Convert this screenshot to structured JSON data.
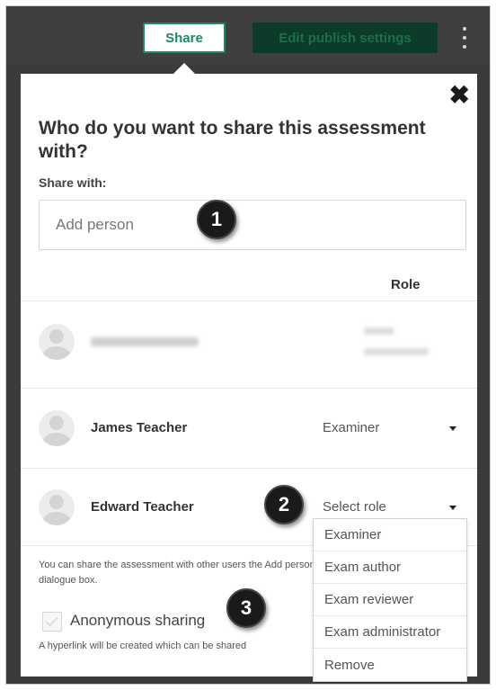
{
  "topbar": {
    "share_label": "Share",
    "publish_label": "Edit publish settings"
  },
  "dialog": {
    "title": "Who do you want to share this assessment with?",
    "share_with_label": "Share with:",
    "add_person_placeholder": "Add person",
    "role_header": "Role",
    "people": [
      {
        "name": "",
        "role": ""
      },
      {
        "name": "James Teacher",
        "role": "Examiner"
      },
      {
        "name": "Edward Teacher",
        "role": "Select role"
      }
    ],
    "info_text": "You can share the assessment with other users the Add person dialogue box.",
    "anonymous_label": "Anonymous sharing",
    "anonymous_checked": true,
    "hyperlink_note": "A hyperlink will be created which can be shared"
  },
  "role_dropdown": {
    "options": [
      "Examiner",
      "Exam author",
      "Exam reviewer",
      "Exam administrator",
      "Remove"
    ]
  },
  "callouts": [
    "1",
    "2",
    "3"
  ],
  "colors": {
    "accent": "#1c8a64",
    "publish_bg": "#0c3b2a",
    "topbar_bg": "#3f3f3f",
    "badge_bg": "#1a1a1a"
  }
}
